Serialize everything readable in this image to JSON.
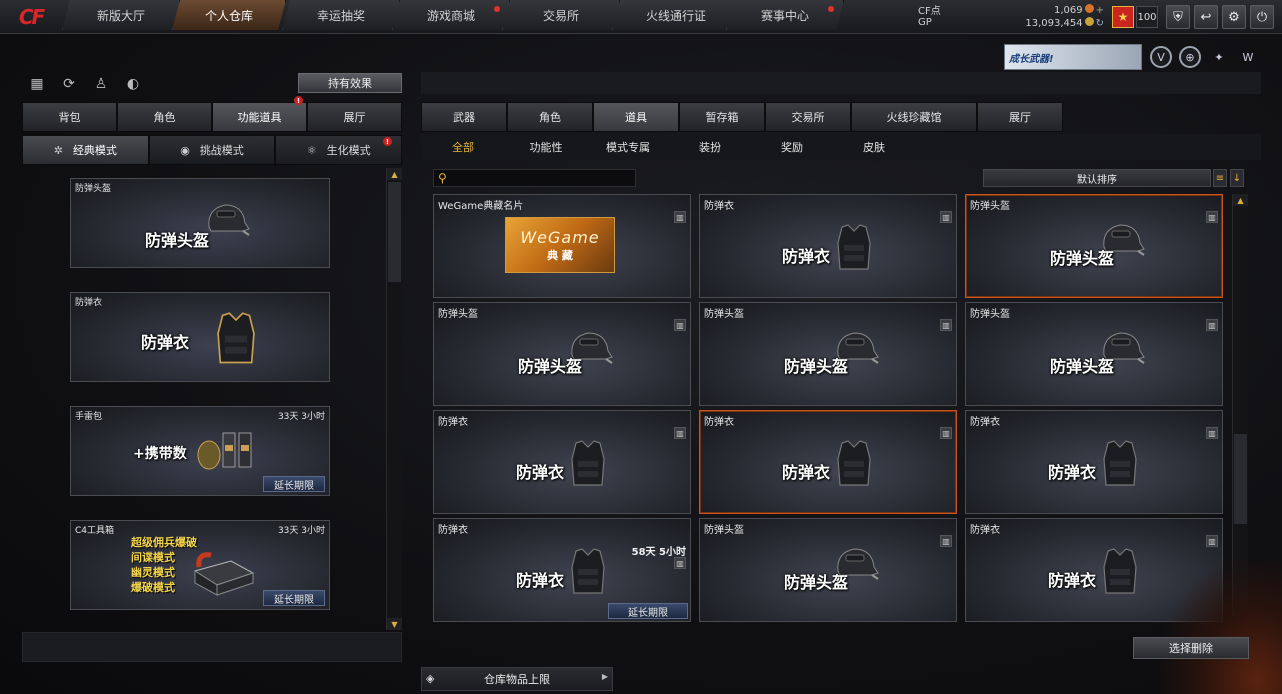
{
  "logo": {
    "text": "CF",
    "accent": "#d8262a"
  },
  "nav": {
    "tabs": [
      {
        "label": "新版大厅",
        "active": false
      },
      {
        "label": "个人仓库",
        "active": true
      },
      {
        "label": "幸运抽奖",
        "active": false
      },
      {
        "label": "游戏商城",
        "active": false
      },
      {
        "label": "交易所",
        "active": false
      },
      {
        "label": "火线通行证",
        "active": false
      },
      {
        "label": "赛事中心",
        "active": false
      }
    ]
  },
  "currency": {
    "cf_label": "CF点",
    "cf_value": "1,069",
    "gp_label": "GP",
    "gp_value": "13,093,454"
  },
  "player": {
    "rank_icon": "star-rank-icon",
    "level": "100"
  },
  "toolbar_icons": [
    "shield-icon",
    "return-icon",
    "gear-icon",
    "power-icon"
  ],
  "left": {
    "icons": [
      "rank-chart-icon",
      "refresh-icon",
      "character-icon",
      "mouse-icon"
    ],
    "effect_button": "持有效果",
    "tabs": [
      {
        "label": "背包",
        "active": false
      },
      {
        "label": "角色",
        "active": false
      },
      {
        "label": "功能道具",
        "active": true
      },
      {
        "label": "展厅",
        "active": false
      }
    ],
    "modes": [
      {
        "label": "经典模式",
        "active": true
      },
      {
        "label": "挑战模式",
        "active": false
      },
      {
        "label": "生化模式",
        "active": false
      }
    ],
    "items": [
      {
        "name": "防弹头盔",
        "display": "防弹头盔",
        "kind": "helmet",
        "time": ""
      },
      {
        "name": "防弹衣",
        "display": "防弹衣",
        "kind": "vest",
        "time": ""
      },
      {
        "name": "手雷包",
        "display": "+携带数",
        "kind": "grenade",
        "time": "33天 3小时",
        "extend": "延长期限"
      },
      {
        "name": "C4工具箱",
        "display_lines": [
          "超级佣兵爆破",
          "间谍模式",
          "幽灵模式",
          "爆破模式"
        ],
        "kind": "c4",
        "time": "33天 3小时",
        "extend": "延长期限"
      }
    ]
  },
  "right": {
    "banner": "成长武器!",
    "tabs": [
      {
        "label": "武器",
        "active": false
      },
      {
        "label": "角色",
        "active": false
      },
      {
        "label": "道具",
        "active": true
      },
      {
        "label": "暂存箱",
        "active": false
      },
      {
        "label": "交易所",
        "active": false
      },
      {
        "label": "火线珍藏馆",
        "active": false
      },
      {
        "label": "展厅",
        "active": false
      }
    ],
    "subtabs": [
      {
        "label": "全部",
        "active": true
      },
      {
        "label": "功能性",
        "active": false
      },
      {
        "label": "模式专属",
        "active": false
      },
      {
        "label": "装扮",
        "active": false
      },
      {
        "label": "奖励",
        "active": false
      },
      {
        "label": "皮肤",
        "active": false
      }
    ],
    "search_placeholder": "",
    "sort_label": "默认排序",
    "grid": [
      {
        "name": "WeGame典藏名片",
        "kind": "wegame",
        "wegame_logo": "WeGame",
        "wegame_sub": "典 藏"
      },
      {
        "name": "防弹衣",
        "kind": "vest",
        "display": "防弹衣"
      },
      {
        "name": "防弹头盔",
        "kind": "helmet",
        "display": "防弹头盔",
        "selected": true
      },
      {
        "name": "防弹头盔",
        "kind": "helmet",
        "display": "防弹头盔"
      },
      {
        "name": "防弹头盔",
        "kind": "helmet",
        "display": "防弹头盔"
      },
      {
        "name": "防弹头盔",
        "kind": "helmet",
        "display": "防弹头盔"
      },
      {
        "name": "防弹衣",
        "kind": "vest",
        "display": "防弹衣"
      },
      {
        "name": "防弹衣",
        "kind": "vest",
        "display": "防弹衣",
        "selected": true
      },
      {
        "name": "防弹衣",
        "kind": "vest",
        "display": "防弹衣"
      },
      {
        "name": "防弹衣",
        "kind": "vest",
        "display": "防弹衣",
        "time": "58天 5小时",
        "extend": "延长期限"
      },
      {
        "name": "防弹头盔",
        "kind": "helmet",
        "display": "防弹头盔"
      },
      {
        "name": "防弹衣",
        "kind": "vest",
        "display": "防弹衣"
      }
    ],
    "delete_button": "选择删除",
    "capacity_button": "仓库物品上限"
  }
}
